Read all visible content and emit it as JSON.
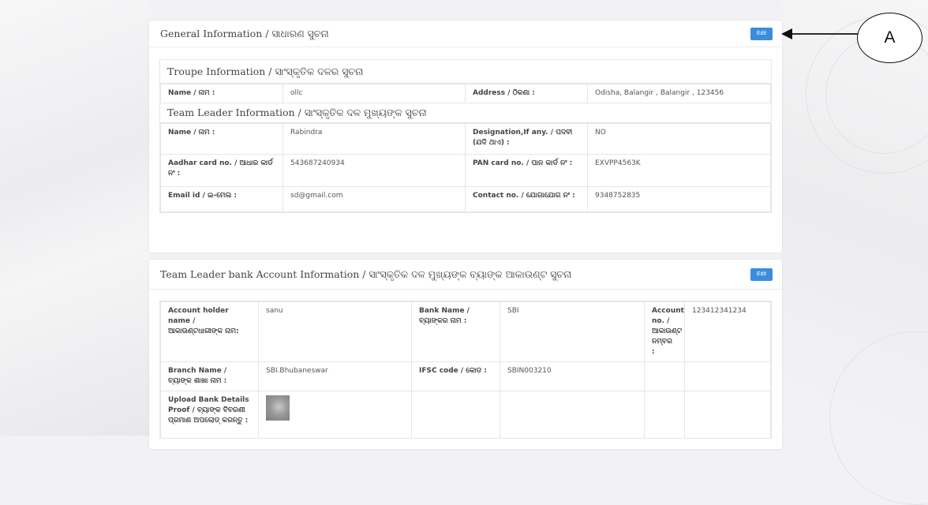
{
  "general": {
    "title": "General Information / ସାଧାରଣ ସୁଚନା",
    "edit_label": "Edit",
    "troupe": {
      "heading": "Troupe Information / ସାଂସ୍କୃତିକ ଦଳର ସୁଚନା",
      "name_label": "Name / ନାମ :",
      "name_value": "ollc",
      "address_label": "Address / ଠିକଣା :",
      "address_value": "Odisha, Balangir , Balangir , 123456"
    },
    "leader": {
      "heading": "Team Leader Information / ସାଂସ୍କୃତିକ ଦଳ ମୁଖ୍ୟଙ୍କ ସୁଚନା",
      "name_label": "Name / ନାମ :",
      "name_value": "Rabindra",
      "designation_label": "Designation,If any. / ପଦବୀ (ଯଦି ଥାଏ) :",
      "designation_value": "NO",
      "aadhar_label": "Aadhar card no. / ଆଧାର କାର୍ଡ ନଂ :",
      "aadhar_value": "543687240934",
      "pan_label": "PAN card no. / ପାନ କାର୍ଡ ନଂ :",
      "pan_value": "EXVPP4563K",
      "email_label": "Email id / ଇ-ମେଲ :",
      "email_value": "sd@gmail.com",
      "contact_label": "Contact no. / ଯୋଗାଯୋଗ ନଂ :",
      "contact_value": "9348752835"
    }
  },
  "bank": {
    "title": "Team Leader bank Account Information / ସାଂସ୍କୃତିକ ଦଳ ମୁଖ୍ୟଙ୍କ ବ୍ୟାଙ୍କ ଆକାଉଣ୍ଟ ସୁଚନା",
    "edit_label": "Edit",
    "holder_label": "Account holder name / ଆକାଉଣ୍ଟଧାରୀଙ୍କ ନାମ:",
    "holder_value": "sanu",
    "bank_name_label": "Bank Name / ବ୍ୟାଙ୍କର ନାମ :",
    "bank_name_value": "SBI",
    "account_no_label": "Account no. / ଆକାଉଣ୍ଟ ନମ୍ବର :",
    "account_no_value": "123412341234",
    "branch_label": "Branch Name / ବ୍ୟାଙ୍କ ଶାଖା ନାମ :",
    "branch_value": "SBI.Bhubaneswar",
    "ifsc_label": "IFSC code / କୋଡ :",
    "ifsc_value": "SBIN003210",
    "upload_label": "Upload Bank Details Proof / ବ୍ୟାଙ୍କ ବିବରଣୀ ପ୍ରମାଣ ଅପଲୋଡ୍ କରନ୍ତୁ :"
  },
  "annotation": {
    "label": "A"
  },
  "colors": {
    "edit_button": "#3b8ddb",
    "page_background": "#f2f2f4"
  }
}
